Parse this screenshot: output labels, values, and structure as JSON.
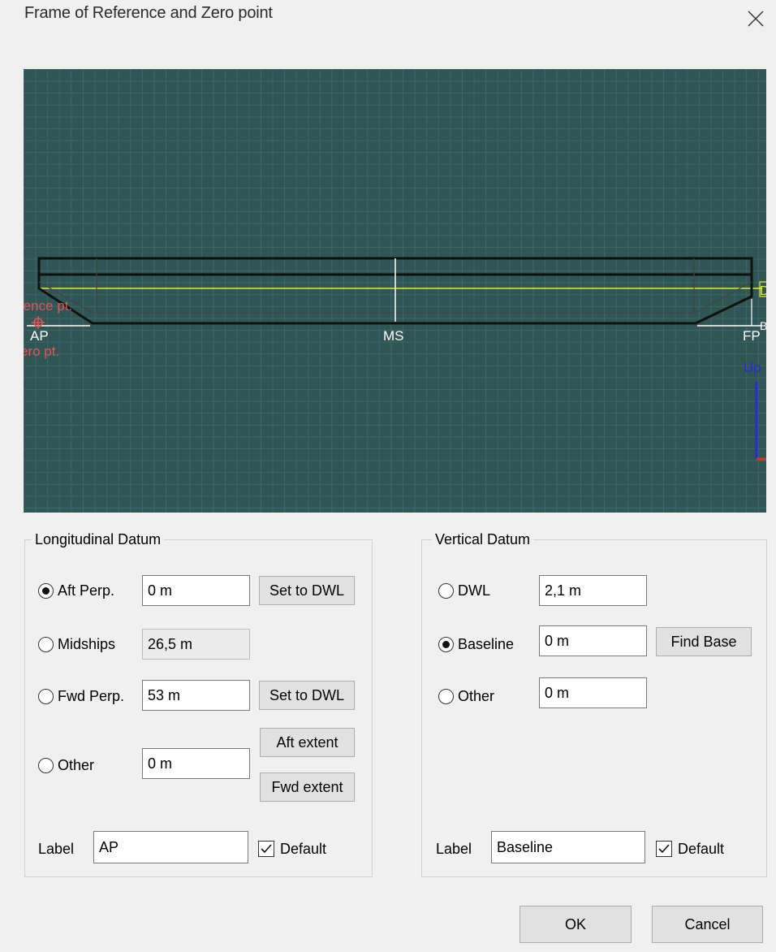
{
  "window": {
    "title": "Frame of Reference and Zero point"
  },
  "preview": {
    "ref_label_1": "rence pt.",
    "ref_label_2": "ero pt.",
    "ap_label": "AP",
    "ms_label": "MS",
    "fp_label": "FP",
    "up_label": "Up",
    "dwl_marker_label": "D",
    "fp_extra_label": "B",
    "colors": {
      "background": "#2f5555",
      "grid": "#3f6767",
      "hull": "#111111",
      "dwl_line": "#e8e83a",
      "reference": "#e05555",
      "up_axis": "#2a2ad8"
    }
  },
  "longitudinal": {
    "title": "Longitudinal Datum",
    "aft_perp": {
      "label": "Aft Perp.",
      "value": "0 m",
      "selected": true,
      "button": "Set to DWL"
    },
    "midships": {
      "label": "Midships",
      "value": "26,5 m",
      "selected": false
    },
    "fwd_perp": {
      "label": "Fwd Perp.",
      "value": "53 m",
      "selected": false,
      "button": "Set to DWL"
    },
    "other": {
      "label": "Other",
      "value": "0 m",
      "selected": false,
      "aft_button": "Aft extent",
      "fwd_button": "Fwd extent"
    },
    "label_caption": "Label",
    "label_value": "AP",
    "default_label": "Default",
    "default_checked": true
  },
  "vertical": {
    "title": "Vertical Datum",
    "dwl": {
      "label": "DWL",
      "value": "2,1 m",
      "selected": false
    },
    "baseline": {
      "label": "Baseline",
      "value": "0 m",
      "selected": true,
      "button": "Find Base"
    },
    "other": {
      "label": "Other",
      "value": "0 m",
      "selected": false
    },
    "label_caption": "Label",
    "label_value": "Baseline",
    "default_label": "Default",
    "default_checked": true
  },
  "footer": {
    "ok": "OK",
    "cancel": "Cancel"
  }
}
